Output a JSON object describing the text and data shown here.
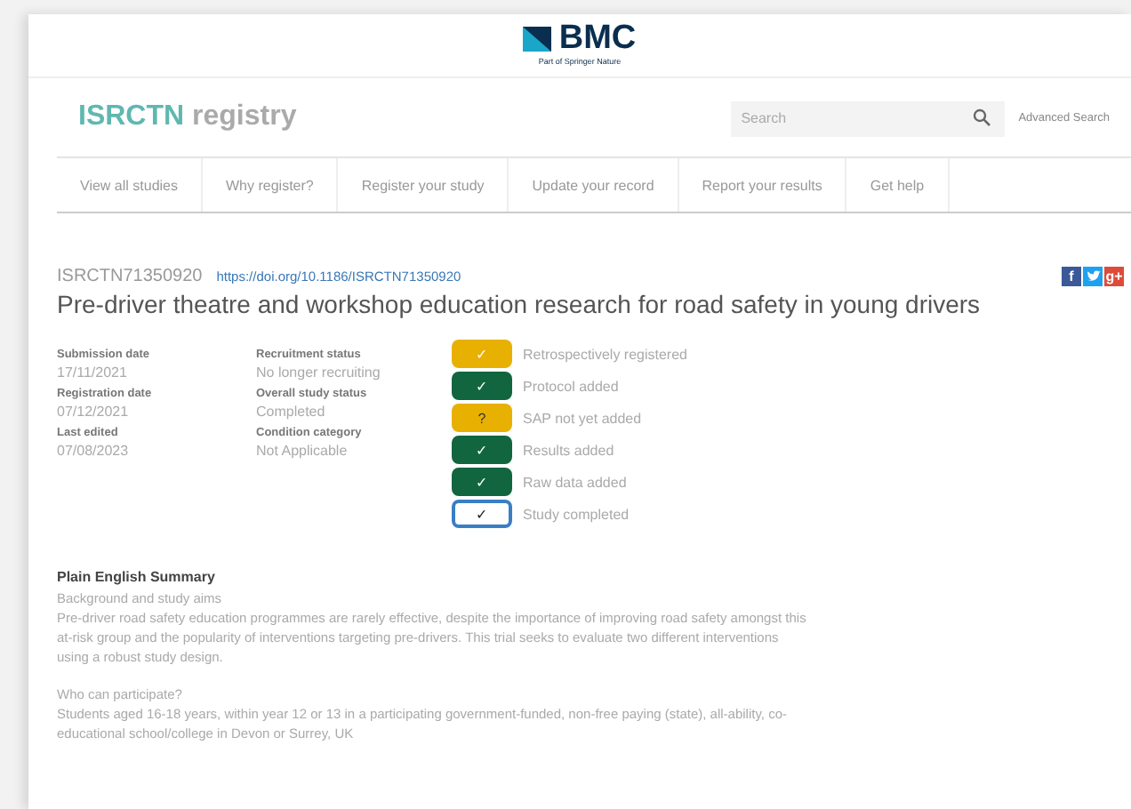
{
  "publisher": {
    "name": "BMC",
    "tagline": "Part of Springer Nature"
  },
  "registry": {
    "name_bold": "ISRCTN",
    "name_rest": "registry"
  },
  "search": {
    "placeholder": "Search",
    "advanced": "Advanced Search"
  },
  "nav": [
    {
      "label": "View all studies"
    },
    {
      "label": "Why register?"
    },
    {
      "label": "Register your study"
    },
    {
      "label": "Update your record"
    },
    {
      "label": "Report your results"
    },
    {
      "label": "Get help"
    }
  ],
  "study": {
    "id": "ISRCTN71350920",
    "doi": "https://doi.org/10.1186/ISRCTN71350920",
    "title": "Pre-driver theatre and workshop education research for road safety in young drivers"
  },
  "share": [
    {
      "label": "f",
      "color": "#3b5998"
    },
    {
      "kind": "bird",
      "color": "#1da1f2"
    },
    {
      "label": "g+",
      "color": "#dd4b39"
    }
  ],
  "details": [
    [
      {
        "label": "Submission date",
        "value": "17/11/2021"
      },
      {
        "label": "Registration date",
        "value": "07/12/2021"
      },
      {
        "label": "Last edited",
        "value": "07/08/2023"
      }
    ],
    [
      {
        "label": "Recruitment status",
        "value": "No longer recruiting"
      },
      {
        "label": "Overall study status",
        "value": "Completed"
      },
      {
        "label": "Condition category",
        "value": "Not Applicable"
      }
    ]
  ],
  "statuses": [
    {
      "kind": "filled",
      "color": "#e8b000",
      "symbol": "✓",
      "label": "Retrospectively registered"
    },
    {
      "kind": "filled",
      "color": "#12663f",
      "symbol": "✓",
      "label": "Protocol added"
    },
    {
      "kind": "filled",
      "color": "#e8b000",
      "symbol": "?",
      "label": "SAP not yet added"
    },
    {
      "kind": "filled",
      "color": "#12663f",
      "symbol": "✓",
      "label": "Results added"
    },
    {
      "kind": "filled",
      "color": "#12663f",
      "symbol": "✓",
      "label": "Raw data added"
    },
    {
      "kind": "outline",
      "color": "#3a7fc4",
      "symbol": "✓",
      "label": "Study completed"
    }
  ],
  "summary": {
    "heading": "Plain English Summary",
    "sections": [
      {
        "subheading": "Background and study aims",
        "text": "Pre-driver road safety education programmes are rarely effective, despite the importance of improving road safety amongst this at-risk group and the popularity of interventions targeting pre-drivers. This trial seeks to evaluate two different interventions using a robust study design."
      },
      {
        "subheading": "Who can participate?",
        "text": "Students aged 16-18 years, within year 12 or 13 in a participating government-funded, non-free paying (state), all-ability, co-educational school/college in Devon or Surrey, UK"
      }
    ]
  }
}
